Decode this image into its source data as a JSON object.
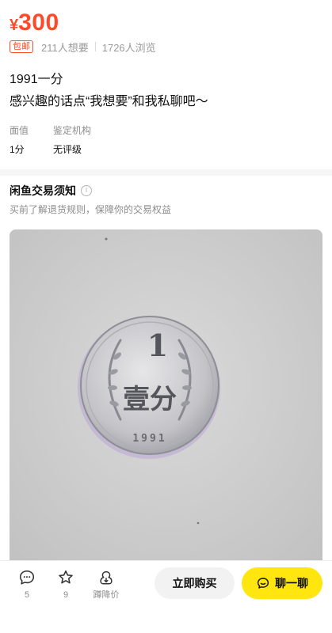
{
  "listing": {
    "price_currency": "¥",
    "price_value": "300",
    "free_shipping": "包邮",
    "want_count": "211人想要",
    "view_count": "1726人浏览",
    "title": "1991一分",
    "description": "感兴趣的话点“我想要”和我私聊吧～"
  },
  "attributes": [
    {
      "label": "面值",
      "value": "1分"
    },
    {
      "label": "鉴定机构",
      "value": "无评级"
    }
  ],
  "notice": {
    "title": "闲鱼交易须知",
    "info_icon": "i",
    "subtitle": "买前了解退货规则，保障你的交易权益"
  },
  "photo": {
    "coin_value": "1",
    "coin_text": "壹分",
    "coin_year": "1991",
    "background_color": "#cfcfcf",
    "coin_color": "#c9c9cc"
  },
  "bottom_bar": {
    "comments_count": "5",
    "favorites_count": "9",
    "price_drop_label": "蹲降价",
    "buy_label": "立即购买",
    "chat_label": "聊一聊"
  },
  "colors": {
    "price": "#ff4a2a",
    "chat_button": "#ffe60f",
    "buy_button": "#f2f2f2"
  }
}
